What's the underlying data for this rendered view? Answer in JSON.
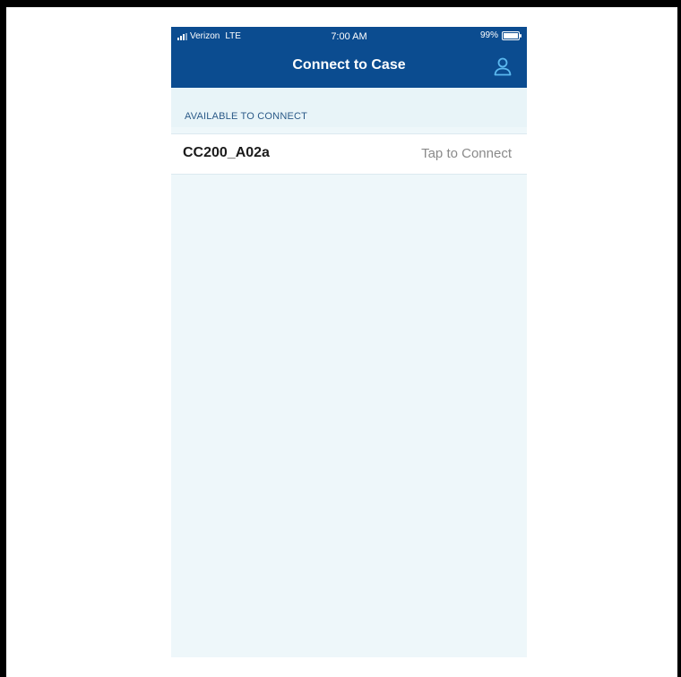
{
  "status_bar": {
    "carrier": "Verizon",
    "network": "LTE",
    "time": "7:00 AM",
    "battery": "99%"
  },
  "nav": {
    "title": "Connect to Case",
    "profile_icon": "person-icon"
  },
  "section": {
    "header": "AVAILABLE TO CONNECT"
  },
  "devices": [
    {
      "name": "CC200_A02a",
      "action": "Tap to Connect"
    }
  ],
  "colors": {
    "nav_bar": "#0b4c90",
    "background": "#eef7fa",
    "section_text": "#2b5a88",
    "accent_icon": "#5bb8ef"
  }
}
